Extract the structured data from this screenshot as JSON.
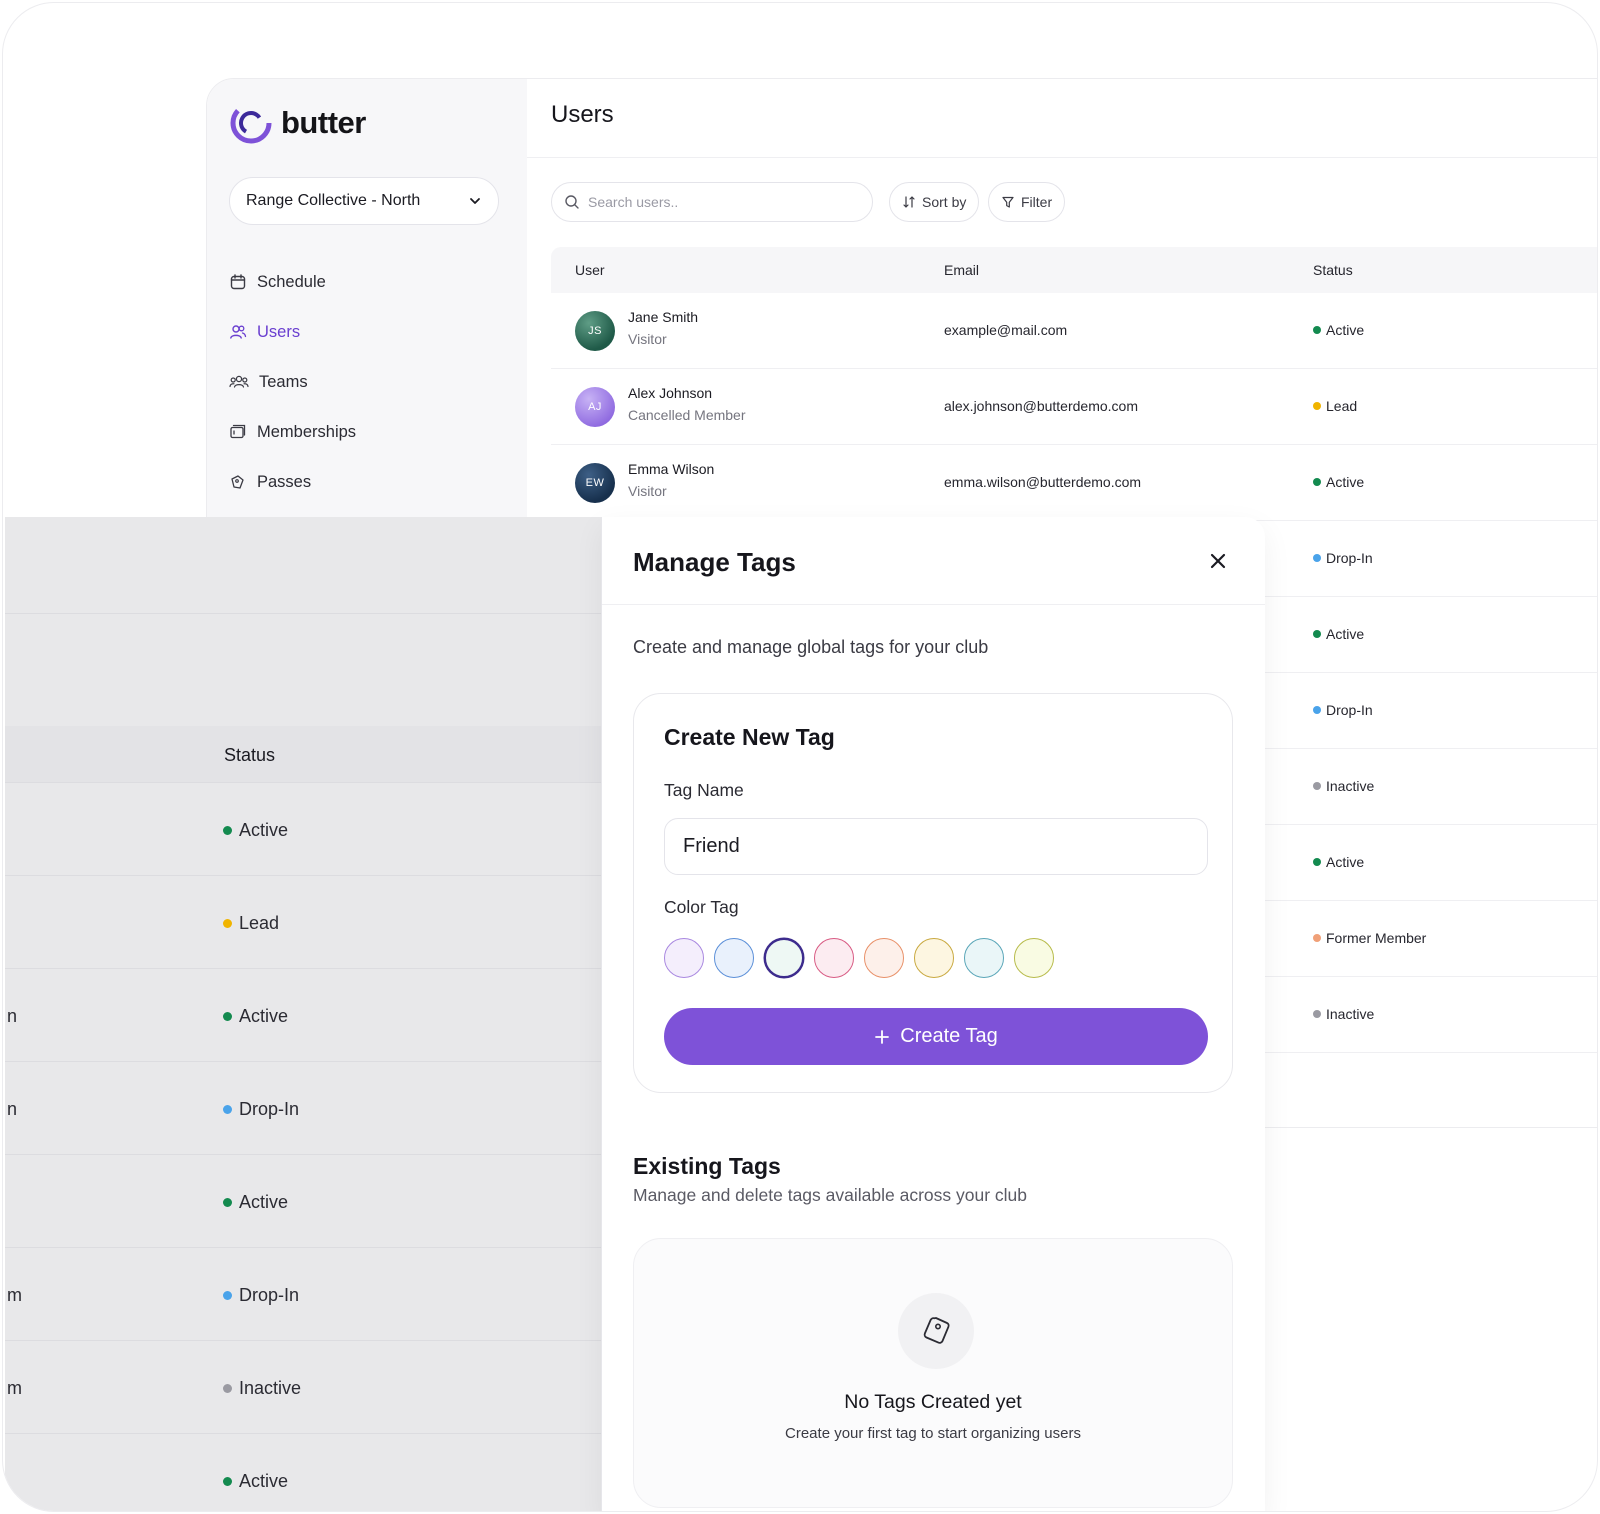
{
  "brand": {
    "name": "butter",
    "accent": "#7e52d8"
  },
  "club_selector": {
    "value": "Range Collective - North"
  },
  "nav": [
    {
      "label": "Schedule",
      "icon": "calendar-icon",
      "active": false
    },
    {
      "label": "Users",
      "icon": "users-icon",
      "active": true
    },
    {
      "label": "Teams",
      "icon": "teams-icon",
      "active": false
    },
    {
      "label": "Memberships",
      "icon": "memberships-icon",
      "active": false
    },
    {
      "label": "Passes",
      "icon": "passes-icon",
      "active": false
    }
  ],
  "page": {
    "title": "Users",
    "search_placeholder": "Search users..",
    "sort_label": "Sort by",
    "filter_label": "Filter"
  },
  "table": {
    "columns": [
      "User",
      "Email",
      "Status"
    ],
    "rows": [
      {
        "initials": "JS",
        "name": "Jane Smith",
        "subtitle": "Visitor",
        "email": "example@mail.com",
        "status": "Active",
        "avatar_color": "#1f5a48"
      },
      {
        "initials": "AJ",
        "name": "Alex Johnson",
        "subtitle": "Cancelled Member",
        "email": "alex.johnson@butterdemo.com",
        "status": "Lead",
        "avatar_color": "#a98ae8"
      },
      {
        "initials": "EW",
        "name": "Emma Wilson",
        "subtitle": "Visitor",
        "email": "emma.wilson@butterdemo.com",
        "status": "Active",
        "avatar_color": "#17304d"
      }
    ],
    "hidden_rows_status": [
      "Drop-In",
      "Active",
      "Drop-In",
      "Inactive",
      "Active",
      "Former Member",
      "Inactive"
    ]
  },
  "status_colors": {
    "Active": "#138a4f",
    "Lead": "#f0b400",
    "Drop-In": "#4aa3ea",
    "Inactive": "#9a9aa2",
    "Former Member": "#f0a078"
  },
  "overlay": {
    "status_label": "Status",
    "statuses": [
      "Active",
      "Lead",
      "Active",
      "Drop-In",
      "Active",
      "Drop-In",
      "Inactive",
      "Active"
    ],
    "truncated_fragments": [
      "n",
      "n",
      "m",
      "m"
    ]
  },
  "modal": {
    "title": "Manage Tags",
    "description": "Create and manage global tags for your club",
    "create_card": {
      "title": "Create New Tag",
      "tag_name_label": "Tag Name",
      "tag_name_value": "Friend",
      "color_label": "Color Tag",
      "colors": [
        {
          "fill": "#f4eefc",
          "border": "#a988e0"
        },
        {
          "fill": "#e9f1fc",
          "border": "#5b8fd8"
        },
        {
          "fill": "#eef8f4",
          "border": "#3d2c8d",
          "selected": true
        },
        {
          "fill": "#fcecf1",
          "border": "#d85a83"
        },
        {
          "fill": "#fdf0ea",
          "border": "#e89068"
        },
        {
          "fill": "#fdf6e1",
          "border": "#c9a940"
        },
        {
          "fill": "#eaf6f8",
          "border": "#5aa6b8"
        },
        {
          "fill": "#f9fbe3",
          "border": "#b7bb4a"
        }
      ],
      "button_label": "Create Tag"
    },
    "existing": {
      "title": "Existing Tags",
      "description": "Manage and delete tags available across your club",
      "empty_title": "No Tags Created yet",
      "empty_subtitle": "Create your first tag to start organizing users"
    }
  }
}
